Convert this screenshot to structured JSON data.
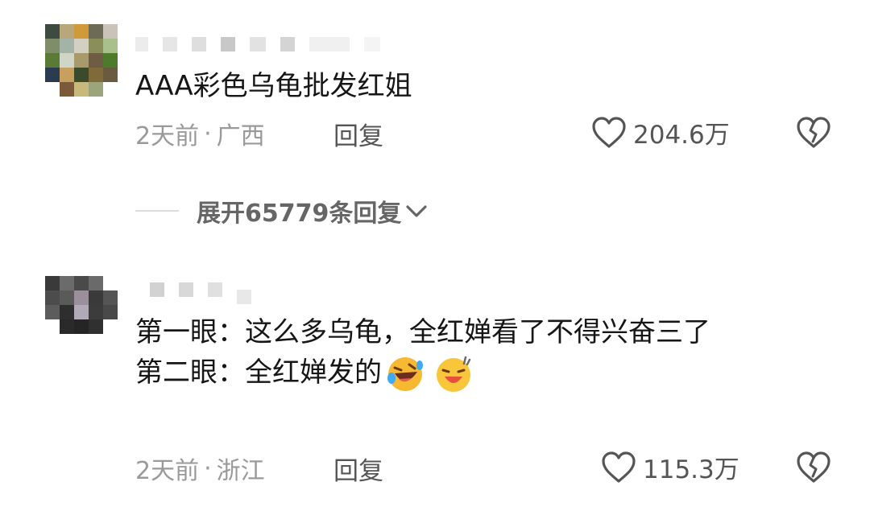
{
  "comments": [
    {
      "text": "AAA彩色乌龟批发红姐",
      "time": "2天前",
      "separator": "·",
      "location": "广西",
      "reply_label": "回复",
      "likes": "204.6万",
      "avatar_colors": [
        "#3e4b40",
        "#b8a77a",
        "#d09a3a",
        "#6d6a55",
        "#c9c3ba",
        "#7f8d6a",
        "#a3b3a8",
        "#d4cfc3",
        "#8a8f5a",
        "#a9c08c",
        "#5a7a36",
        "#cfd6c7",
        "#a89a6a",
        "#6e5d44",
        "#4e7a2c",
        "#2b3b52",
        "#c7a060",
        "#3b4a2a",
        "#806a3a",
        "#6a5a40",
        "#ffffff",
        "#7b5a3a",
        "#c8b87a",
        "#9aa67a",
        "#ffffff"
      ]
    },
    {
      "text": "第一眼：这么多乌龟，全红婵看了不得兴奋三了\n第二眼：全红婵发的",
      "time": "2天前",
      "separator": "·",
      "location": "浙江",
      "reply_label": "回复",
      "likes": "115.3万",
      "avatar_colors": [
        "#3a3a3a",
        "#6b6b6b",
        "#4a4a4a",
        "#6a6a6a",
        "#ffffff",
        "#4c4c4c",
        "#5a5a5a",
        "#9a8f9a",
        "#3a3a3a",
        "#555555",
        "#5c5c5c",
        "#2e2e2e",
        "#b0aab8",
        "#3c3c3c",
        "#494949",
        "#ffffff",
        "#2a2a2a",
        "#252525",
        "#303030",
        "#ffffff"
      ]
    }
  ],
  "expand_replies": "展开65779条回复",
  "icons": {
    "like": "heart-outline-icon",
    "dislike": "broken-heart-icon",
    "expand": "chevron-down-icon",
    "emoji1": "rolling-laughing-emoji",
    "emoji2": "laughing-sweat-emoji"
  },
  "colors": {
    "meta": "#9a9a9a",
    "text": "#161616",
    "action": "#555555"
  }
}
